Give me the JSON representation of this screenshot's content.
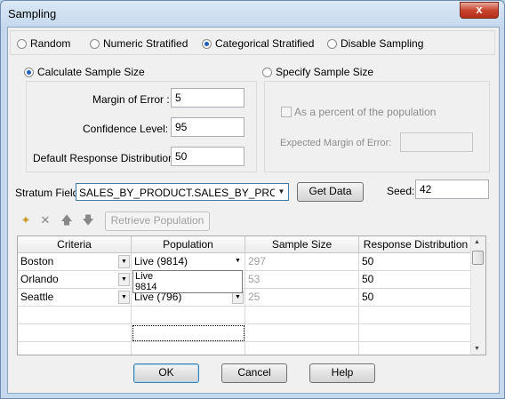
{
  "window": {
    "title": "Sampling",
    "close_glyph": "x"
  },
  "sampling_mode": {
    "options": [
      "Random",
      "Numeric Stratified",
      "Categorical Stratified",
      "Disable Sampling"
    ],
    "selected": "Categorical Stratified"
  },
  "calculate": {
    "label": "Calculate Sample Size",
    "margin_label": "Margin of Error :",
    "margin_value": "5",
    "confidence_label": "Confidence Level:",
    "confidence_value": "95",
    "response_label": "Default Response Distribution:",
    "response_value": "50"
  },
  "specify": {
    "label": "Specify Sample Size",
    "percent_label": "As a percent of the population",
    "expected_label": "Expected Margin of Error:",
    "expected_value": ""
  },
  "stratum": {
    "label": "Stratum Field:",
    "value": "SALES_BY_PRODUCT.SALES_BY_PRODUCT",
    "get_data_label": "Get Data",
    "seed_label": "Seed:",
    "seed_value": "42"
  },
  "toolbar": {
    "retrieve_label": "Retrieve Population"
  },
  "grid": {
    "headers": [
      "Criteria",
      "Population",
      "Sample Size",
      "Response Distribution"
    ],
    "rows": [
      {
        "criteria": "Boston",
        "population": "Live (9814)",
        "sample": "297",
        "response": "50"
      },
      {
        "criteria": "Orlando",
        "population": "",
        "sample": "53",
        "response": "50"
      },
      {
        "criteria": "Seattle",
        "population": "Live (796)",
        "sample": "25",
        "response": "50"
      }
    ],
    "popup_line1": "Live",
    "popup_line2": "9814"
  },
  "buttons": {
    "ok": "OK",
    "cancel": "Cancel",
    "help": "Help"
  },
  "colors": {
    "accent": "#1e5fbf",
    "title_bar": "#c4d8ee",
    "close": "#c7452f"
  }
}
